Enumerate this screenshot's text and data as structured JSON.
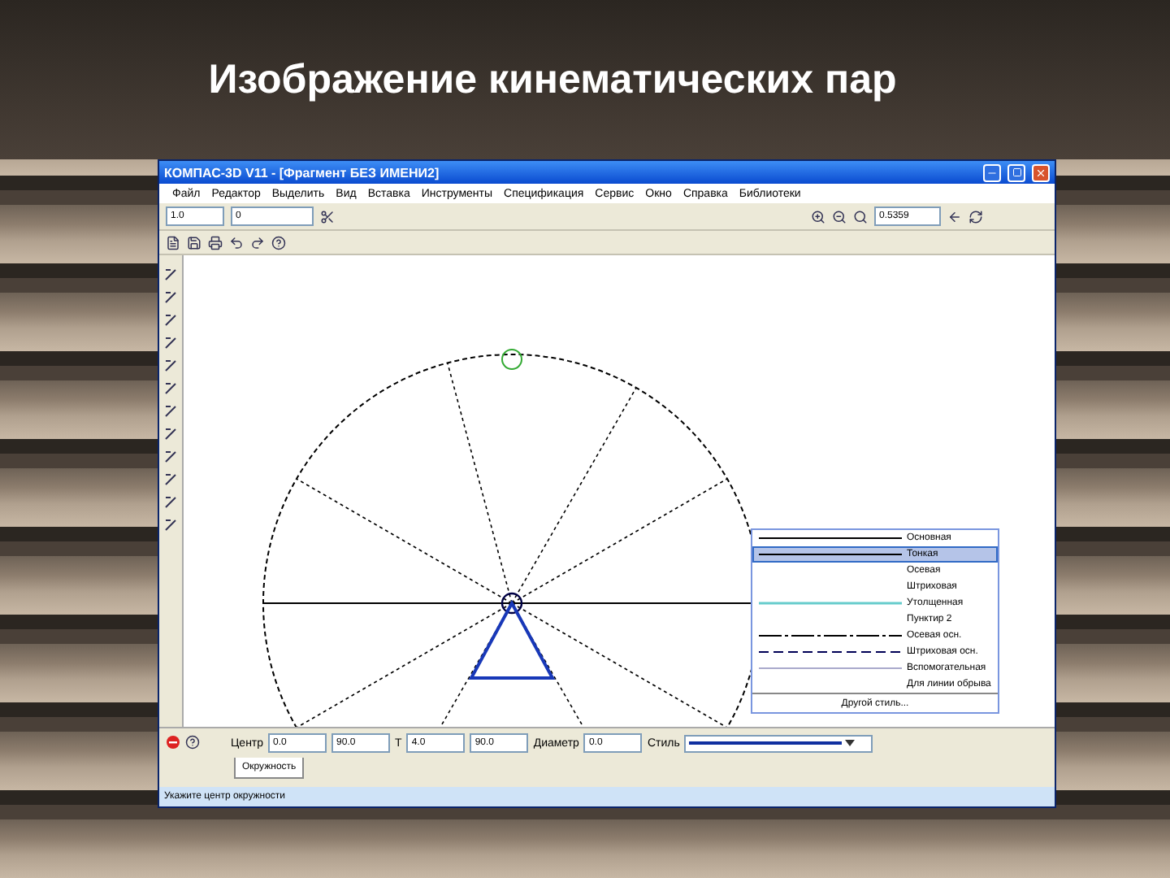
{
  "slide": {
    "title": "Изображение кинематических пар"
  },
  "window": {
    "title": "КОМПАС-3D V11 - [Фрагмент БЕЗ ИМЕНИ2]"
  },
  "menu": [
    "Файл",
    "Редактор",
    "Выделить",
    "Вид",
    "Вставка",
    "Инструменты",
    "Спецификация",
    "Сервис",
    "Окно",
    "Справка",
    "Библиотеки"
  ],
  "toolbar": {
    "layer_value": "1.0",
    "style_value": "0",
    "scale_value": "0.5359"
  },
  "line_styles": [
    {
      "label": "Основная",
      "kind": "solid",
      "selected": false
    },
    {
      "label": "Тонкая",
      "kind": "solid",
      "selected": true
    },
    {
      "label": "Осевая",
      "kind": "none",
      "selected": false
    },
    {
      "label": "Штриховая",
      "kind": "none",
      "selected": false
    },
    {
      "label": "Утолщенная",
      "kind": "thick",
      "selected": false
    },
    {
      "label": "Пунктир 2",
      "kind": "none",
      "selected": false
    },
    {
      "label": "Осевая осн.",
      "kind": "dashdot",
      "selected": false
    },
    {
      "label": "Штриховая осн.",
      "kind": "dashed",
      "selected": false
    },
    {
      "label": "Вспомогательная",
      "kind": "thin",
      "selected": false
    },
    {
      "label": "Для линии обрыва",
      "kind": "none",
      "selected": false
    }
  ],
  "other_style": "Другой стиль...",
  "property_bar": {
    "fields": [
      {
        "label": "Центр",
        "value": "0.0"
      },
      {
        "value": "90.0"
      },
      {
        "label": "Т",
        "value": "4.0"
      },
      {
        "value": "90.0"
      },
      {
        "label": "Диаметр",
        "value": "0.0"
      }
    ],
    "style_label": "Стиль",
    "tab": "Окружность"
  },
  "status_bar": "Укажите центр окружности"
}
